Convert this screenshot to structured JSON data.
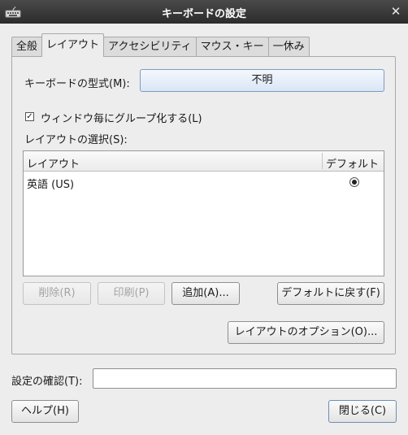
{
  "window": {
    "title": "キーボードの設定",
    "close_glyph": "✕",
    "icon": "keyboard-icon"
  },
  "tabs": [
    {
      "label": "全般",
      "active": false
    },
    {
      "label": "レイアウト",
      "active": true
    },
    {
      "label": "アクセシビリティ",
      "active": false
    },
    {
      "label": "マウス・キー",
      "active": false
    },
    {
      "label": "一休み",
      "active": false
    }
  ],
  "layout_tab": {
    "model_label": "キーボードの型式(M):",
    "model_value": "不明",
    "per_window_label": "ウィンドウ毎にグループ化する(L)",
    "per_window_checked": true,
    "selection_label": "レイアウトの選択(S):",
    "table": {
      "columns": [
        "レイアウト",
        "デフォルト"
      ],
      "rows": [
        {
          "layout": "英語 (US)",
          "default": true
        }
      ]
    },
    "buttons": {
      "remove": "削除(R)",
      "print": "印刷(P)",
      "add": "追加(A)...",
      "reset": "デフォルトに戻す(F)",
      "options": "レイアウトのオプション(O)..."
    }
  },
  "footer": {
    "test_label": "設定の確認(T):",
    "test_value": "",
    "help_button": "ヘルプ(H)",
    "close_button": "閉じる(C)"
  }
}
